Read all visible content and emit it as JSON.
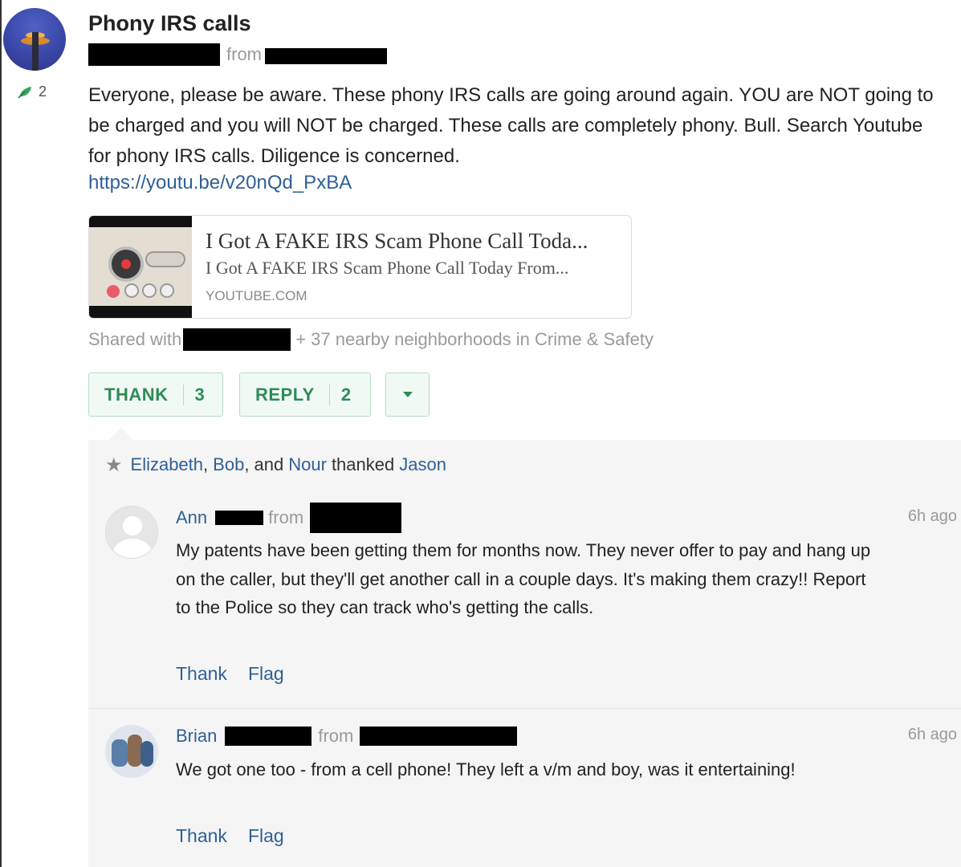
{
  "post": {
    "title": "Phony IRS calls",
    "from_label": "from",
    "thanks_badge": "2",
    "body": "Everyone, please be aware. These phony IRS calls are going around again. YOU are NOT going to be charged and you will NOT be charged. These calls are completely phony. Bull. Search Youtube for phony IRS calls. Diligence is concerned.",
    "link": "https://youtu.be/v20nQd_PxBA"
  },
  "embed": {
    "title": "I Got A FAKE IRS Scam Phone Call Toda...",
    "description": "I Got A FAKE IRS Scam Phone Call Today From...",
    "domain": "YOUTUBE.COM"
  },
  "shared": {
    "prefix": "Shared with",
    "suffix": "+ 37 nearby neighborhoods in Crime & Safety"
  },
  "actions": {
    "thank_label": "THANK",
    "thank_count": "3",
    "reply_label": "REPLY",
    "reply_count": "2"
  },
  "thanked": {
    "name1": "Elizabeth",
    "sep1": ",",
    "name2": "Bob",
    "sep2": ", and",
    "name3": "Nour",
    "verb": "thanked",
    "target": "Jason"
  },
  "comments": [
    {
      "name": "Ann",
      "from_label": "from",
      "time": "6h ago",
      "body": "My patents have been getting them for months now. They never offer to pay and hang up on the caller, but they'll get another call in a couple days. It's making them crazy!! Report to the Police so they can track who's getting the calls.",
      "thank": "Thank",
      "flag": "Flag"
    },
    {
      "name": "Brian",
      "from_label": "from",
      "time": "6h ago",
      "body": "We got one too - from a cell phone! They left a v/m and boy, was it entertaining!",
      "thank": "Thank",
      "flag": "Flag"
    }
  ],
  "colors": {
    "link_blue": "#2f5f96",
    "action_green": "#2e8b57",
    "muted_gray": "#9a9a9a"
  }
}
